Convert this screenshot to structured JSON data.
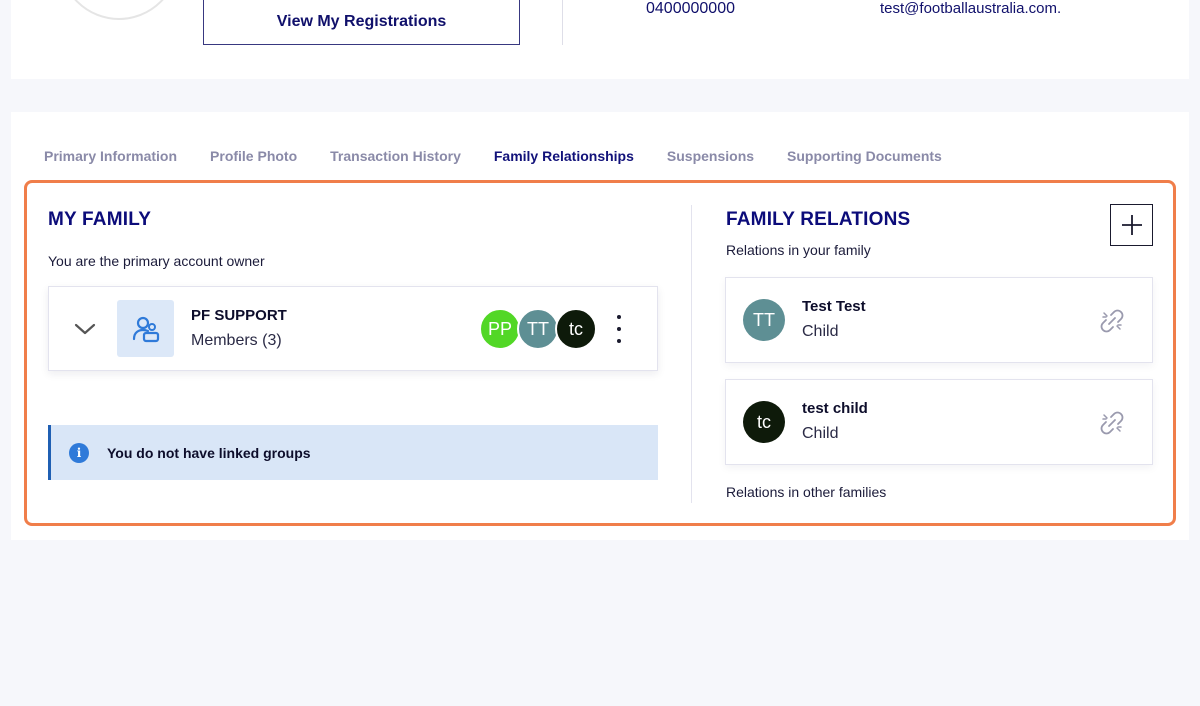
{
  "header": {
    "view_registrations_label": "View My Registrations",
    "phone": "0400000000",
    "email": "test@footballaustralia.com."
  },
  "tabs": [
    {
      "label": "Primary Information",
      "active": false
    },
    {
      "label": "Profile Photo",
      "active": false
    },
    {
      "label": "Transaction History",
      "active": false
    },
    {
      "label": "Family Relationships",
      "active": true
    },
    {
      "label": "Suspensions",
      "active": false
    },
    {
      "label": "Supporting Documents",
      "active": false
    }
  ],
  "my_family": {
    "title": "MY FAMILY",
    "subtitle": "You are the primary account owner",
    "group": {
      "name": "PF SUPPORT",
      "members_text": "Members (3)",
      "members": [
        {
          "initials": "PP",
          "color": "#52d726"
        },
        {
          "initials": "TT",
          "color": "#5e8f94"
        },
        {
          "initials": "tc",
          "color": "#0e1a0a"
        }
      ]
    },
    "linked_groups_message": "You do not have linked groups"
  },
  "family_relations": {
    "title": "FAMILY RELATIONS",
    "subtitle": "Relations in your family",
    "relations": [
      {
        "initials": "TT",
        "name": "Test Test",
        "role": "Child",
        "color": "#5e8f94"
      },
      {
        "initials": "tc",
        "name": "test child",
        "role": "Child",
        "color": "#0e1a0a"
      }
    ],
    "other_families_label": "Relations in other families"
  },
  "colors": {
    "accent": "#f07e4a",
    "brand_navy": "#0c0c7a",
    "info_bg": "#d9e6f7"
  }
}
